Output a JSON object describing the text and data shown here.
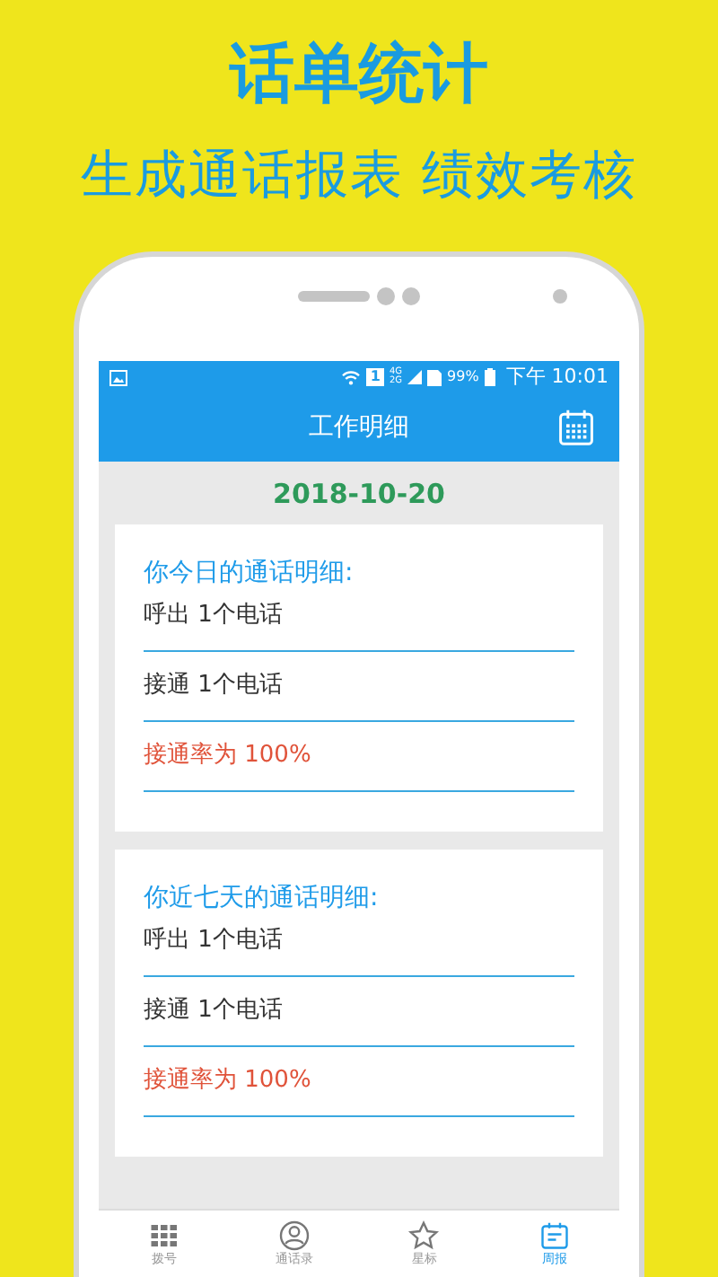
{
  "promo": {
    "title": "话单统计",
    "subtitle": "生成通话报表 绩效考核"
  },
  "status_bar": {
    "sim": "1",
    "network_top": "4G",
    "network_bottom": "2G",
    "battery": "99%",
    "time": "下午 10:01"
  },
  "app_bar": {
    "title": "工作明细"
  },
  "date": "2018-10-20",
  "cards": [
    {
      "heading": "你今日的通话明细:",
      "lines": [
        {
          "text": "呼出 1个电话",
          "kind": "normal"
        },
        {
          "text": "接通 1个电话",
          "kind": "normal"
        },
        {
          "text": "接通率为 100%",
          "kind": "rate"
        }
      ]
    },
    {
      "heading": "你近七天的通话明细:",
      "lines": [
        {
          "text": "呼出 1个电话",
          "kind": "normal"
        },
        {
          "text": "接通 1个电话",
          "kind": "normal"
        },
        {
          "text": "接通率为 100%",
          "kind": "rate"
        }
      ]
    }
  ],
  "bottom_nav": [
    {
      "label": "拨号",
      "selected": false
    },
    {
      "label": "通话录",
      "selected": false
    },
    {
      "label": "星标",
      "selected": false
    },
    {
      "label": "周报",
      "selected": true
    }
  ]
}
